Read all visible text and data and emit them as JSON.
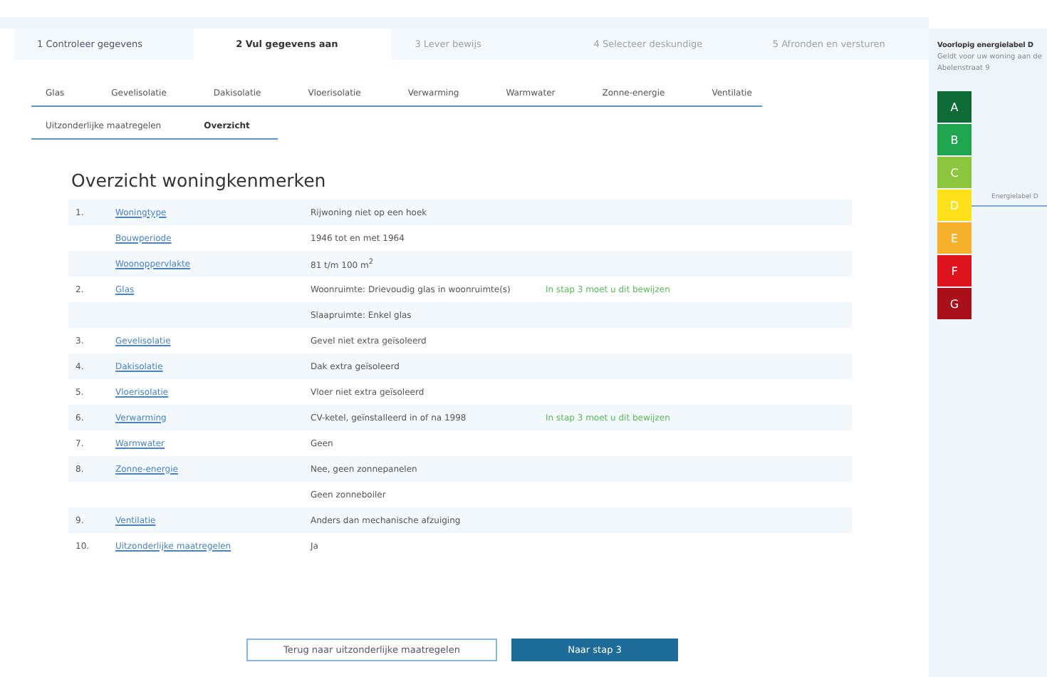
{
  "steps": [
    {
      "label": "1 Controleer gegevens",
      "selected": false,
      "disabled": false
    },
    {
      "label": "2 Vul gegevens aan",
      "selected": true,
      "disabled": false
    },
    {
      "label": "3 Lever bewijs",
      "selected": false,
      "disabled": true
    },
    {
      "label": "4 Selecteer deskundige",
      "selected": false,
      "disabled": true
    },
    {
      "label": "5 Afronden en versturen",
      "selected": false,
      "disabled": true
    }
  ],
  "subtab_rows": [
    [
      {
        "label": "Glas",
        "selected": false
      },
      {
        "label": "Gevelisolatie",
        "selected": false
      },
      {
        "label": "Dakisolatie",
        "selected": false
      },
      {
        "label": "Vloerisolatie",
        "selected": false
      },
      {
        "label": "Verwarming",
        "selected": false
      },
      {
        "label": "Warmwater",
        "selected": false
      },
      {
        "label": "Zonne-energie",
        "selected": false
      },
      {
        "label": "Ventilatie",
        "selected": false
      }
    ],
    [
      {
        "label": "Uitzonderlijke maatregelen",
        "selected": false
      },
      {
        "label": "Overzicht",
        "selected": true
      }
    ]
  ],
  "heading": "Overzicht woningkenmerken",
  "rows": [
    {
      "number": "1.",
      "link": "Woningtype",
      "value": "Rijwoning niet op een hoek"
    },
    {
      "link": "Bouwperiode",
      "value": "1946 tot en met 1964"
    },
    {
      "link": "Woonoppervlakte",
      "value": "81 t/m 100 m$^{2}$"
    },
    {
      "number": "2.",
      "link": "Glas",
      "value": "Woonruimte: Drievoudig glas in woonruimte(s)",
      "note": "In stap 3 moet u dit bewijzen"
    },
    {
      "value": "Slaapruimte: Enkel glas"
    },
    {
      "number": "3.",
      "link": "Gevelisolatie",
      "value": "Gevel niet extra geïsoleerd"
    },
    {
      "number": "4.",
      "link": "Dakisolatie",
      "value": "Dak extra geïsoleerd"
    },
    {
      "number": "5.",
      "link": "Vloerisolatie",
      "value": "Vloer niet extra geïsoleerd"
    },
    {
      "number": "6.",
      "link": "Verwarming",
      "value": "CV-ketel, geïnstalleerd in of na 1998",
      "note": "In stap 3 moet u dit bewijzen"
    },
    {
      "number": "7.",
      "link": "Warmwater",
      "value": "Geen"
    },
    {
      "number": "8.",
      "link": "Zonne-energie",
      "value": "Nee, geen zonnepanelen"
    },
    {
      "value": "Geen zonneboiler"
    },
    {
      "number": "9.",
      "link": "Ventilatie",
      "value": "Anders dan mechanische afzuiging"
    },
    {
      "number": "10.",
      "link": "Uitzonderlijke maatregelen",
      "value": "Ja"
    }
  ],
  "buttons": [
    {
      "label": "Terug naar uitzonderlijke maatregelen",
      "kind": "secondary"
    },
    {
      "label": "Naar stap 3",
      "kind": "primary"
    }
  ],
  "sidebar": {
    "title": "Voorlopig energielabel D",
    "subtitle": "Geldt voor uw woning aan de",
    "address": "Abelenstraat 9",
    "marker_label": "Energielabel D",
    "labels": [
      {
        "letter": "A",
        "color": "#0f6b35",
        "selected": false
      },
      {
        "letter": "B",
        "color": "#1fa550",
        "selected": false
      },
      {
        "letter": "C",
        "color": "#8cc63f",
        "selected": false
      },
      {
        "letter": "D",
        "color": "#ffe11a",
        "selected": true
      },
      {
        "letter": "E",
        "color": "#f6b22c",
        "selected": false
      },
      {
        "letter": "F",
        "color": "#e0141e",
        "selected": false
      },
      {
        "letter": "G",
        "color": "#a8101a",
        "selected": false
      }
    ]
  }
}
